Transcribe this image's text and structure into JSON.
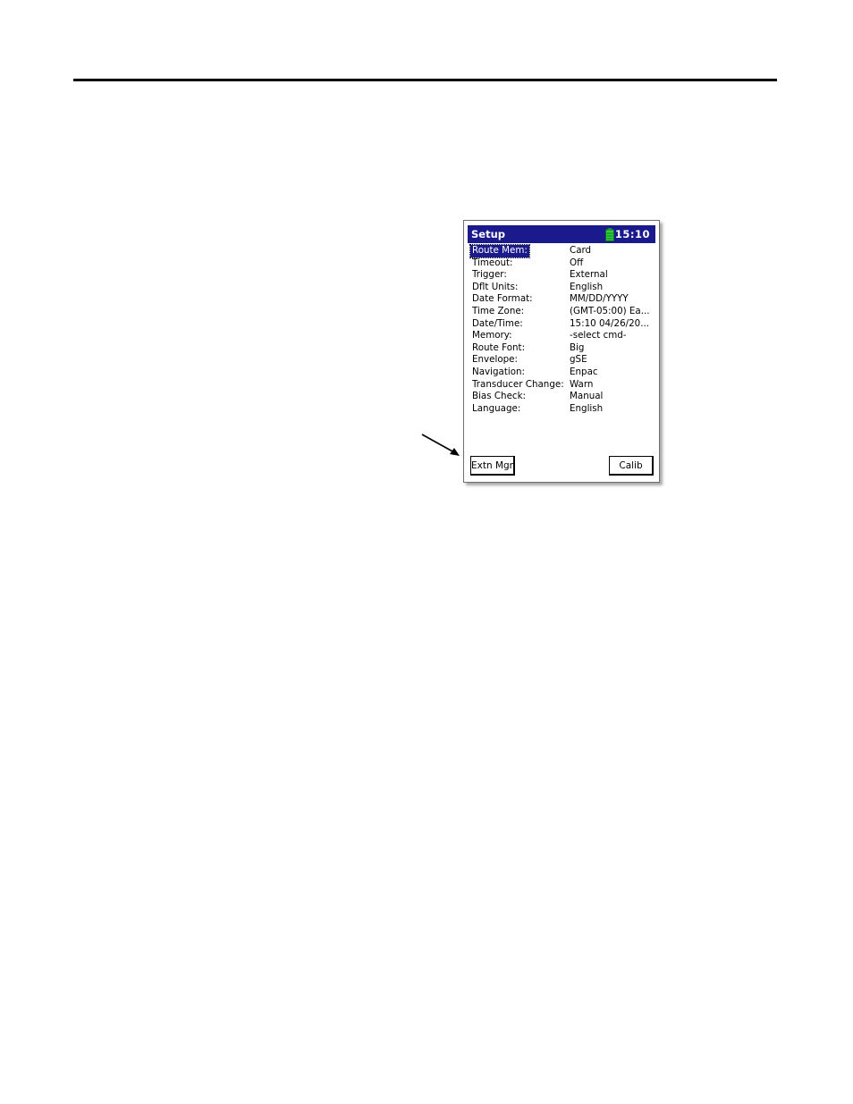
{
  "window": {
    "title": "Setup",
    "time": "15:10",
    "battery_color": "#2ecc40"
  },
  "settings": [
    {
      "label": "Route Mem:",
      "value": "Card"
    },
    {
      "label": "Timeout:",
      "value": "Off"
    },
    {
      "label": "Trigger:",
      "value": "External"
    },
    {
      "label": "Dflt Units:",
      "value": "English"
    },
    {
      "label": "Date Format:",
      "value": "MM/DD/YYYY"
    },
    {
      "label": "Time Zone:",
      "value": "(GMT-05:00) Ea..."
    },
    {
      "label": "Date/Time:",
      "value": "15:10 04/26/20..."
    },
    {
      "label": "Memory:",
      "value": "-select cmd-"
    },
    {
      "label": "Route Font:",
      "value": "Big"
    },
    {
      "label": "Envelope:",
      "value": "gSE"
    },
    {
      "label": "Navigation:",
      "value": "Enpac"
    },
    {
      "label": "Transducer Change:",
      "value": "Warn"
    },
    {
      "label": "Bias Check:",
      "value": "Manual"
    },
    {
      "label": "Language:",
      "value": "English"
    }
  ],
  "buttons": {
    "left": "Extn Mgr",
    "right": "Calib"
  },
  "colors": {
    "titlebar": "#1a1a8c",
    "selection": "#1a1a8c"
  }
}
